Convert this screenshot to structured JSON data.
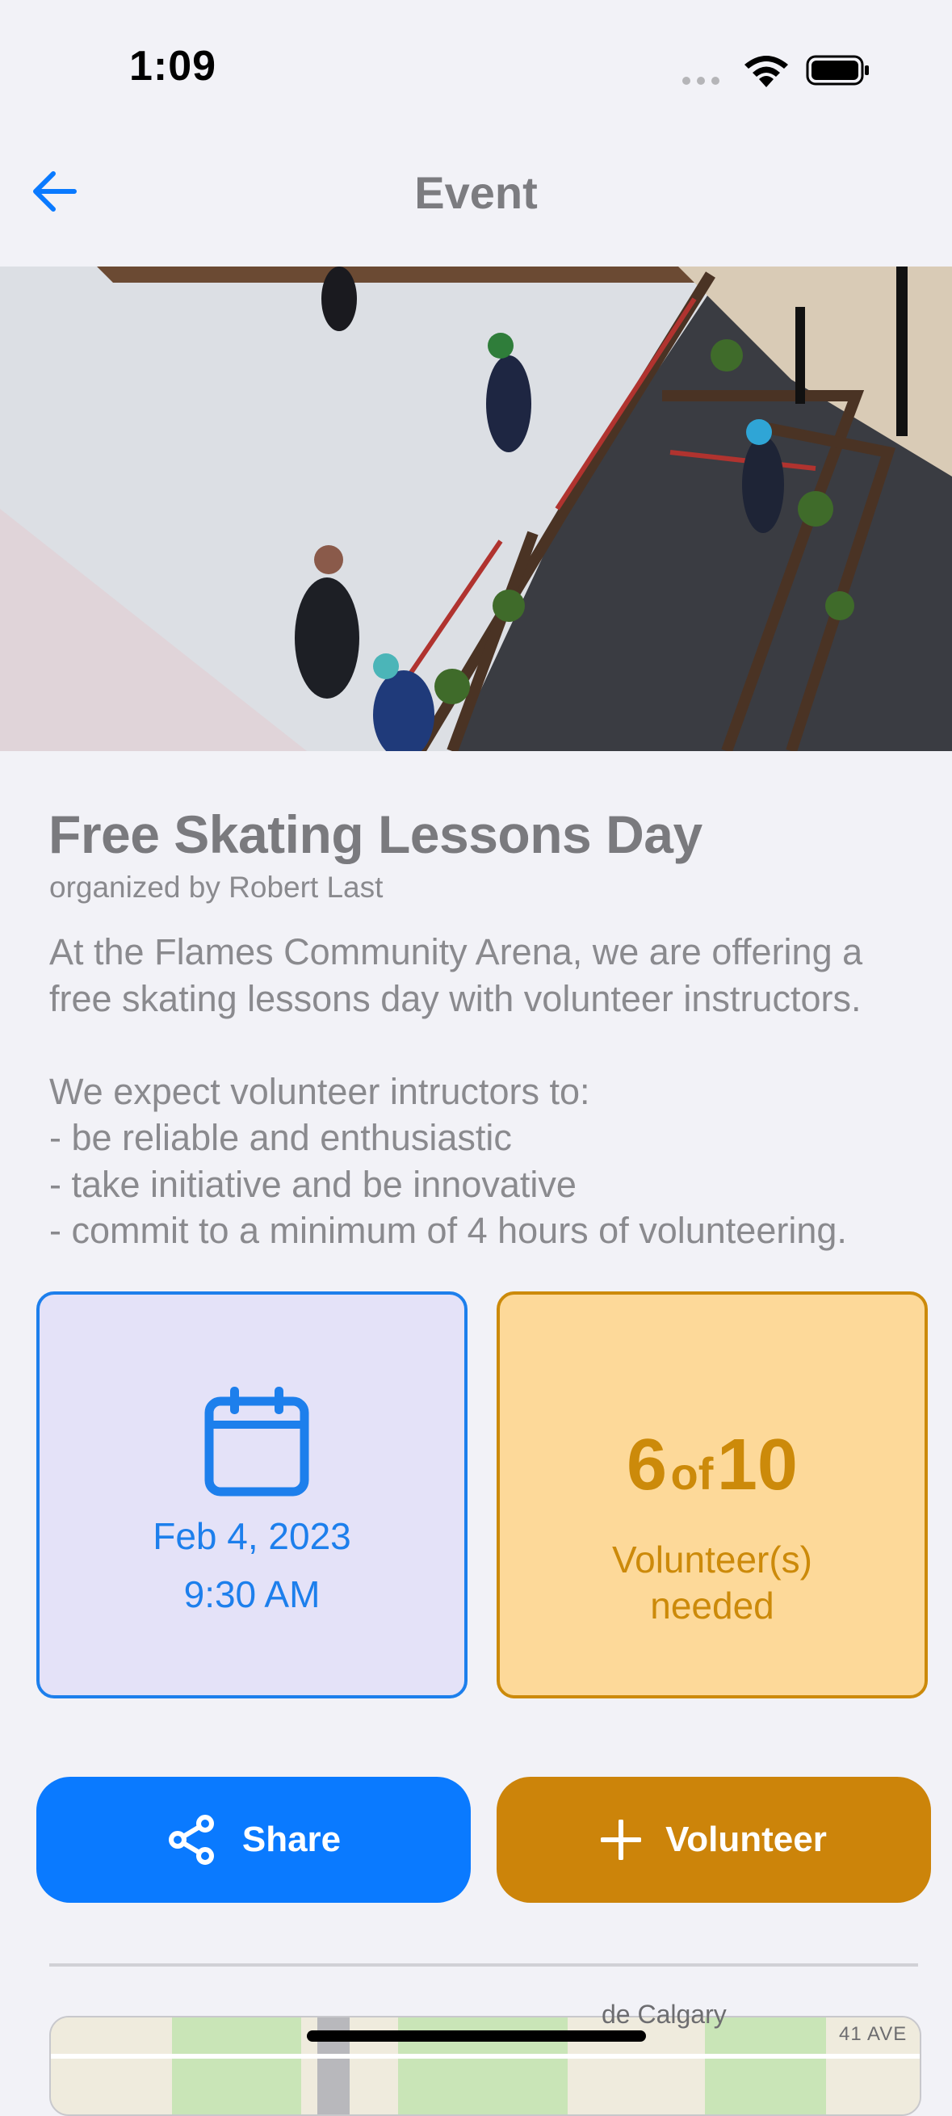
{
  "status_bar": {
    "time": "1:09"
  },
  "nav": {
    "title": "Event"
  },
  "event": {
    "title": "Free Skating Lessons Day",
    "organizer": "organized by Robert Last",
    "description_lines": [
      "At the Flames Community Arena, we are offering a",
      "free skating lessons day with volunteer instructors.",
      "",
      "We expect volunteer intructors to:",
      "- be reliable and enthusiastic",
      "- take initiative and be innovative",
      "- commit to a minimum of 4 hours of volunteering."
    ]
  },
  "date_card": {
    "icon": "calendar-icon",
    "date": "Feb 4, 2023",
    "time": "9:30 AM"
  },
  "volunteer_card": {
    "current": "6",
    "of": "of",
    "total": "10",
    "label_line1": "Volunteer(s)",
    "label_line2": "needed"
  },
  "actions": {
    "share_label": "Share",
    "share_icon": "share-icon",
    "volunteer_label": "Volunteer",
    "volunteer_icon": "plus-icon"
  },
  "map": {
    "label_top": "de Calgary",
    "label_street": "41 AVE"
  },
  "colors": {
    "primary_blue": "#0A7AFF",
    "accent_orange": "#CC840A",
    "date_card_bg": "#E4E2F8",
    "volunteer_card_bg": "#FDD999",
    "background": "#F2F2F7"
  }
}
